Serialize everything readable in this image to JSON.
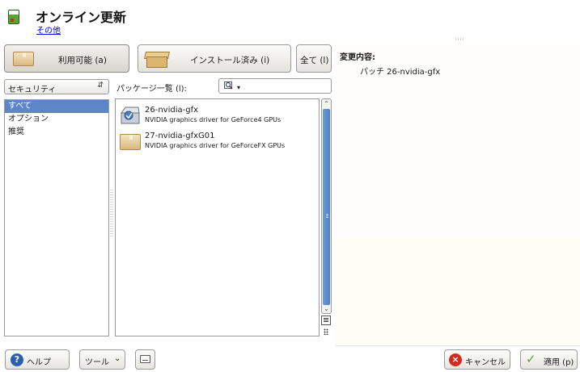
{
  "header": {
    "title": "オンライン更新",
    "other_link": "その他"
  },
  "toolbar": {
    "available_label": "利用可能 (a)",
    "installed_label": "インストール済み (i)",
    "all_label": "全て (l)"
  },
  "filter": {
    "selected": "セキュリティ",
    "categories": [
      "すべて",
      "オプション",
      "推奨"
    ],
    "selected_index": 0
  },
  "packages": {
    "list_label": "パッケージ一覧 (l):",
    "items": [
      {
        "name": "26-nvidia-gfx",
        "desc": "NVIDIA graphics driver for GeForce4 GPUs",
        "status": "installed"
      },
      {
        "name": "27-nvidia-gfxG01",
        "desc": "NVIDIA graphics driver for GeForceFX GPUs",
        "status": "available"
      }
    ]
  },
  "details": {
    "title": "変更内容:",
    "text": "パッチ 26-nvidia-gfx"
  },
  "bottom": {
    "help_label": "ヘルプ",
    "tools_label": "ツール",
    "cancel_label": "キャンセル",
    "apply_label": "適用 (p)"
  },
  "colors": {
    "selection": "#5d86c6",
    "scrollbar": "#5a8ad0",
    "cancel_icon": "#d42a20",
    "apply_icon": "#4aa236",
    "help_icon": "#2a5fb0"
  },
  "icons": [
    "app-icon",
    "package-box-icon",
    "package-open-icon",
    "search-icon",
    "chevron-down-icon",
    "help-icon",
    "cancel-icon",
    "check-icon"
  ]
}
